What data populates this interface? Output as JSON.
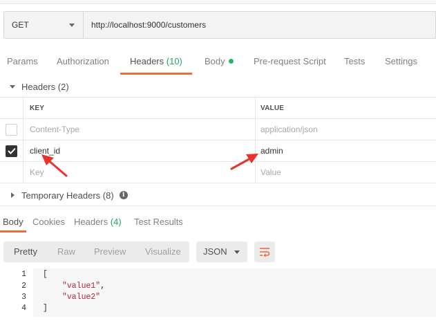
{
  "request": {
    "method": "GET",
    "url": "http://localhost:9000/customers"
  },
  "request_tabs": [
    {
      "label": "Params"
    },
    {
      "label": "Authorization"
    },
    {
      "label": "Headers",
      "count": "(10)"
    },
    {
      "label": "Body"
    },
    {
      "label": "Pre-request Script"
    },
    {
      "label": "Tests"
    },
    {
      "label": "Settings"
    }
  ],
  "headers_section": {
    "title": "Headers",
    "count": "(2)",
    "columns": {
      "key": "KEY",
      "value": "VALUE"
    },
    "rows": [
      {
        "key": "Content-Type",
        "value": "application/json",
        "checked": false
      },
      {
        "key": "client_id",
        "value": "admin",
        "checked": true
      }
    ],
    "placeholder": {
      "key": "Key",
      "value": "Value"
    }
  },
  "temporary_headers": {
    "title": "Temporary Headers",
    "count": "(8)"
  },
  "response_tabs": [
    {
      "label": "Body"
    },
    {
      "label": "Cookies"
    },
    {
      "label": "Headers",
      "count": "(4)"
    },
    {
      "label": "Test Results"
    }
  ],
  "view_modes": [
    "Pretty",
    "Raw",
    "Preview",
    "Visualize"
  ],
  "format": "JSON",
  "code": {
    "line_numbers": [
      "1",
      "2",
      "3",
      "4"
    ],
    "open_bracket": "[",
    "value1": "\"value1\"",
    "comma": ",",
    "value2": "\"value2\"",
    "close_bracket": "]"
  },
  "colors": {
    "accent": "#f26b3a",
    "annotation_arrow": "#e8322b",
    "count_green": "#26a269"
  }
}
